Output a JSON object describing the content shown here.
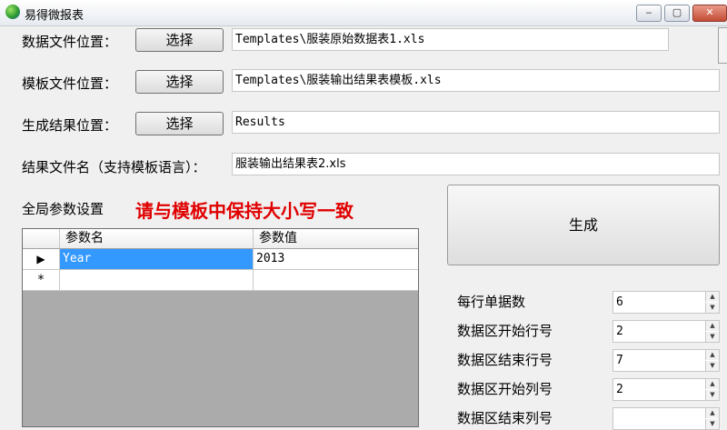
{
  "window": {
    "title": "易得微报表",
    "minimize": "‒",
    "maximize": "▢",
    "close": "✕"
  },
  "data_file": {
    "label": "数据文件位置：",
    "button": "选择",
    "value": "Templates\\服装原始数据表1.xls"
  },
  "template_file": {
    "label": "模板文件位置：",
    "button": "选择",
    "value": "Templates\\服装输出结果表模板.xls"
  },
  "result_path": {
    "label": "生成结果位置：",
    "button": "选择",
    "value": "Results"
  },
  "result_name": {
    "label": "结果文件名（支持模板语言）：",
    "value": "服装输出结果表2.xls"
  },
  "global_params": {
    "label": "全局参数设置",
    "warning": "请与模板中保持大小写一致",
    "columns": [
      "参数名",
      "参数值"
    ],
    "rows": [
      {
        "marker": "▶",
        "name": "Year",
        "value": "2013"
      }
    ],
    "new_row_marker": "*"
  },
  "generate_button": "生成",
  "settings": [
    {
      "label": "每行单据数",
      "value": "6"
    },
    {
      "label": "数据区开始行号",
      "value": "2"
    },
    {
      "label": "数据区结束行号",
      "value": "7"
    },
    {
      "label": "数据区开始列号",
      "value": "2"
    },
    {
      "label": "数据区结束列号",
      "value": ""
    }
  ]
}
